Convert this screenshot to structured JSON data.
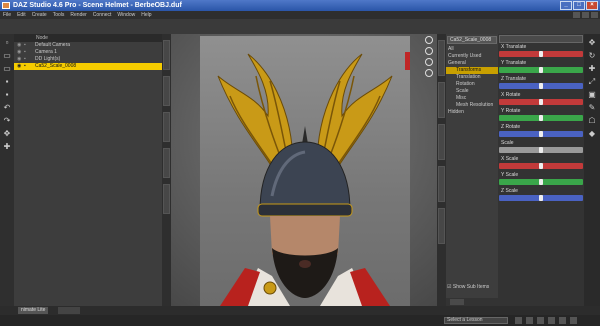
{
  "window": {
    "title": "DAZ Studio 4.6 Pro - Scene Helmet - BerbeOBJ.duf"
  },
  "menu": [
    "File",
    "Edit",
    "Create",
    "Tools",
    "Render",
    "Connect",
    "Window",
    "Help"
  ],
  "scene": {
    "header": "Node",
    "rows": [
      {
        "label": "Default Camera",
        "selected": false
      },
      {
        "label": "Camera 1",
        "selected": false
      },
      {
        "label": "DD Light(s)",
        "selected": false
      },
      {
        "label": "Ca52_Scale_0008",
        "selected": true
      }
    ]
  },
  "params": {
    "combo": "Ca52_Scale_0008",
    "list": [
      {
        "label": "All",
        "selected": false,
        "indent": false
      },
      {
        "label": "Currently Used",
        "selected": false,
        "indent": false
      },
      {
        "label": "General",
        "selected": false,
        "indent": false
      },
      {
        "label": "Transforms",
        "selected": true,
        "indent": true
      },
      {
        "label": "Translation",
        "selected": false,
        "indent": true
      },
      {
        "label": "Rotation",
        "selected": false,
        "indent": true
      },
      {
        "label": "Scale",
        "selected": false,
        "indent": true
      },
      {
        "label": "Misc",
        "selected": false,
        "indent": true
      },
      {
        "label": "Mesh Resolution",
        "selected": false,
        "indent": true
      },
      {
        "label": "Hidden",
        "selected": false,
        "indent": false
      }
    ],
    "show_sub_items": "Show Sub Items"
  },
  "sliders": [
    {
      "label": "X Translate",
      "color": "#c23a3a",
      "value": 0.5
    },
    {
      "label": "Y Translate",
      "color": "#3aa64a",
      "value": 0.5
    },
    {
      "label": "Z Translate",
      "color": "#4a62c2",
      "value": 0.5
    },
    {
      "label": "X Rotate",
      "color": "#c23a3a",
      "value": 0.5
    },
    {
      "label": "Y Rotate",
      "color": "#3aa64a",
      "value": 0.5
    },
    {
      "label": "Z Rotate",
      "color": "#4a62c2",
      "value": 0.5
    },
    {
      "label": "Scale",
      "color": "#9a9a9a",
      "value": 0.5
    },
    {
      "label": "X Scale",
      "color": "#c23a3a",
      "value": 0.5
    },
    {
      "label": "Y Scale",
      "color": "#3aa64a",
      "value": 0.5
    },
    {
      "label": "Z Scale",
      "color": "#4a62c2",
      "value": 0.5
    }
  ],
  "bottom": {
    "tab_label": "nimate Lite",
    "lesson_select": "Select a Lesson"
  }
}
